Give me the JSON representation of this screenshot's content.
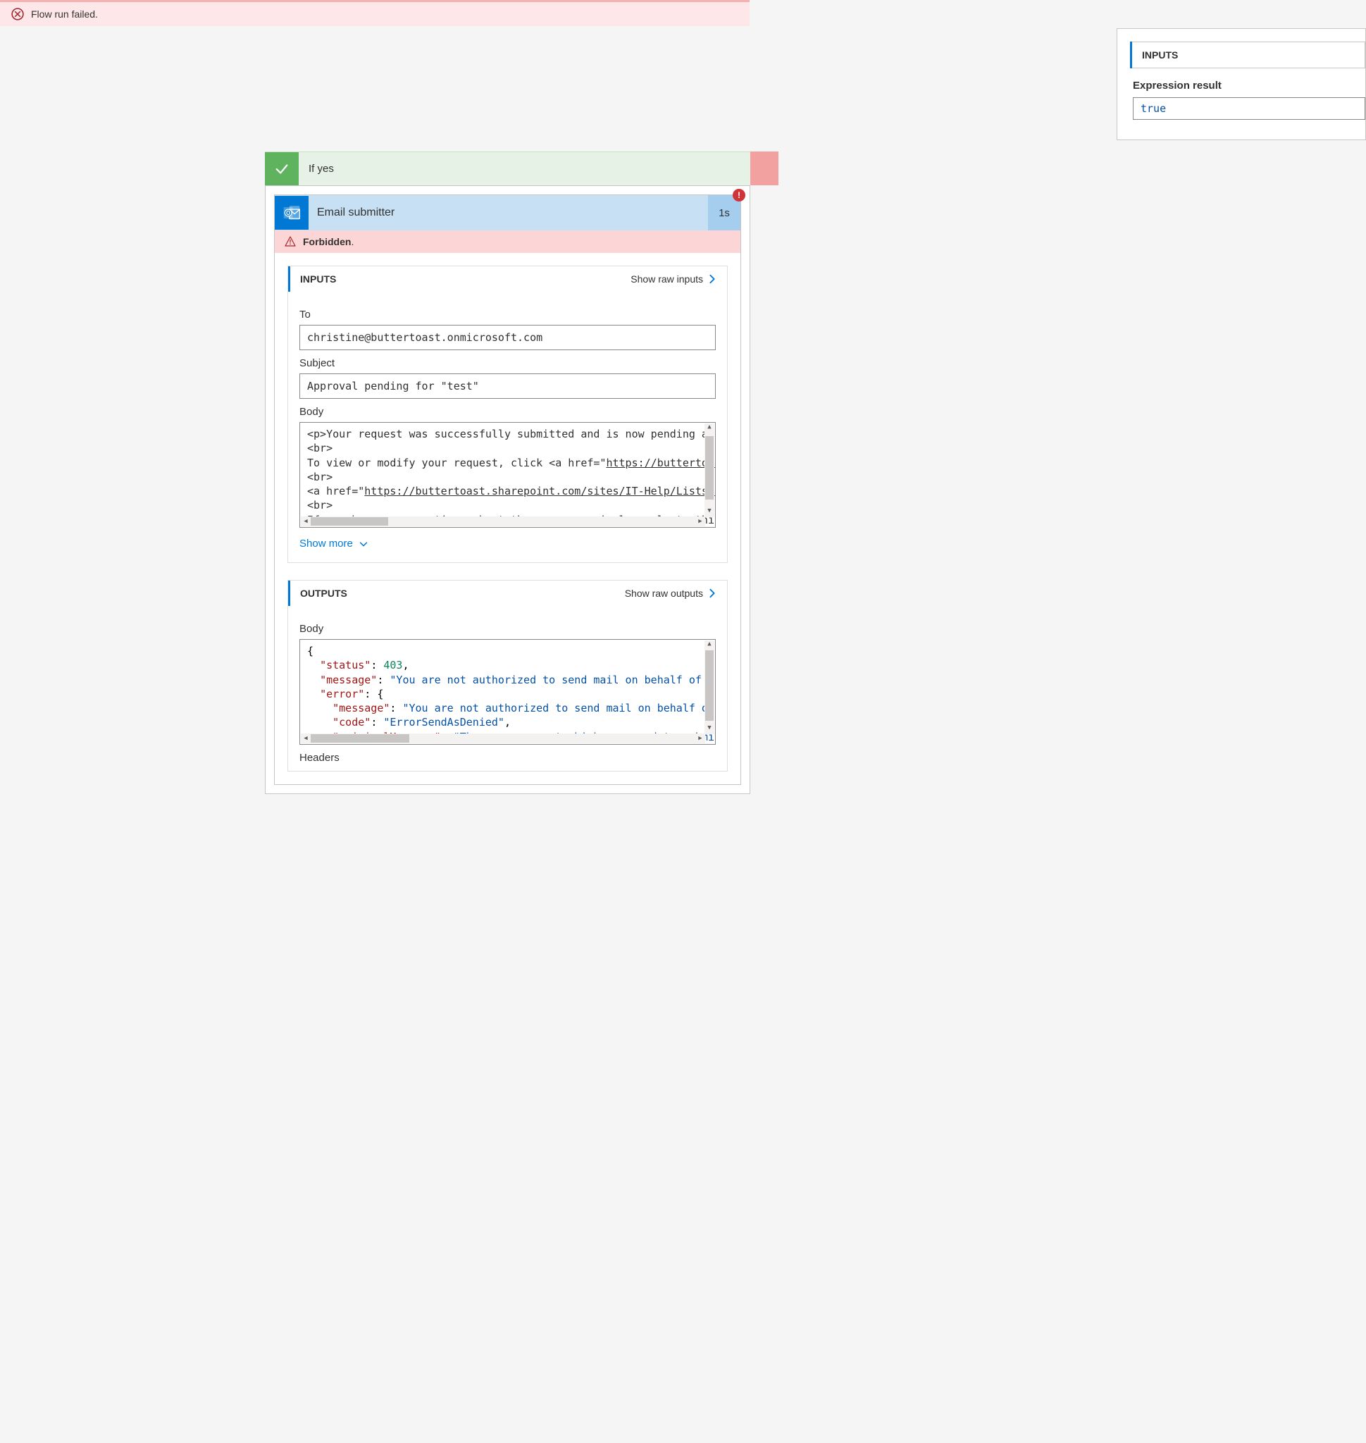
{
  "top_error": {
    "message": "Flow run failed."
  },
  "upper": {
    "section_title": "INPUTS",
    "field_label": "Expression result",
    "field_value": "true"
  },
  "branch_yes": {
    "label": "If yes"
  },
  "action": {
    "title": "Email submitter",
    "duration": "1s",
    "error_short": "Forbidden",
    "error_suffix": ".",
    "badge": "!",
    "inputs": {
      "title": "INPUTS",
      "raw_link": "Show raw inputs",
      "to_label": "To",
      "to_value": "christine@buttertoast.onmicrosoft.com",
      "subject_label": "Subject",
      "subject_value": "Approval pending for \"test\"",
      "body_label": "Body",
      "body_line1": "<p>Your request was successfully submitted and is now pending approval",
      "body_line2": "<br>",
      "body_line3_pre": "To view or modify your request, click <a href=\"",
      "body_line3_url": "https://buttertoast.",
      "body_line4": "<br>",
      "body_line5_pre": "<a href=\"",
      "body_line5_url": "https://buttertoast.sharepoint.com/sites/IT-Help/Lists/IT%",
      "body_line6": "<br>",
      "body_line7": "If you have any questions about the process, simply reply to this e",
      "show_more": "Show more"
    },
    "outputs": {
      "title": "OUTPUTS",
      "raw_link": "Show raw outputs",
      "body_label": "Body",
      "json": {
        "status_k": "\"status\"",
        "status_v": "403",
        "message_k": "\"message\"",
        "message_v": "\"You are not authorized to send mail on behalf of the",
        "error_k": "\"error\"",
        "inner_message_k": "\"message\"",
        "inner_message_v": "\"You are not authorized to send mail on behalf of th",
        "code_k": "\"code\"",
        "code_v": "\"ErrorSendAsDenied\"",
        "orig_k": "\"originalMessage\"",
        "orig_v": "\"The user account which was used to submit t"
      },
      "headers_label": "Headers"
    }
  }
}
